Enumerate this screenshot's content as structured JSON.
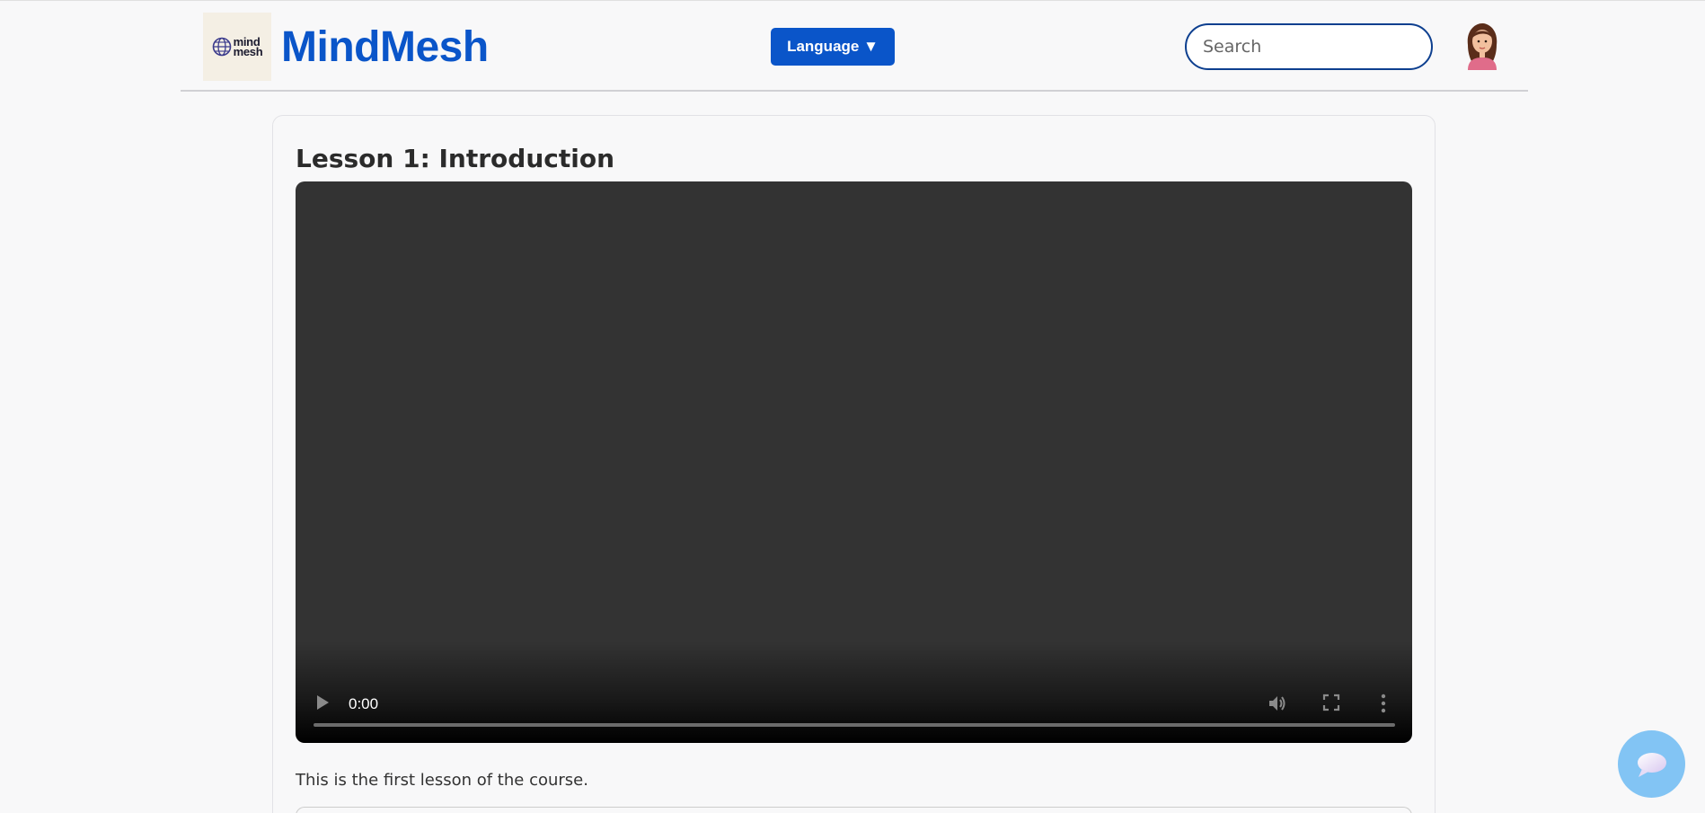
{
  "header": {
    "logo_line1": "mind",
    "logo_line2": "mesh",
    "brand": "MindMesh",
    "language_label": "Language ▼",
    "search_placeholder": "Search"
  },
  "lesson": {
    "title": "Lesson 1: Introduction",
    "description": "This is the first lesson of the course."
  },
  "video": {
    "current_time": "0:00",
    "progress": 0
  },
  "colors": {
    "brand": "#0a55c9",
    "search_border": "#0d3f8f",
    "chat_button": "#82c4f4"
  },
  "icons": {
    "play": "play-icon",
    "volume": "volume-icon",
    "fullscreen": "fullscreen-icon",
    "more": "more-vertical-icon",
    "chat": "chat-bubble-icon",
    "avatar": "user-avatar"
  }
}
